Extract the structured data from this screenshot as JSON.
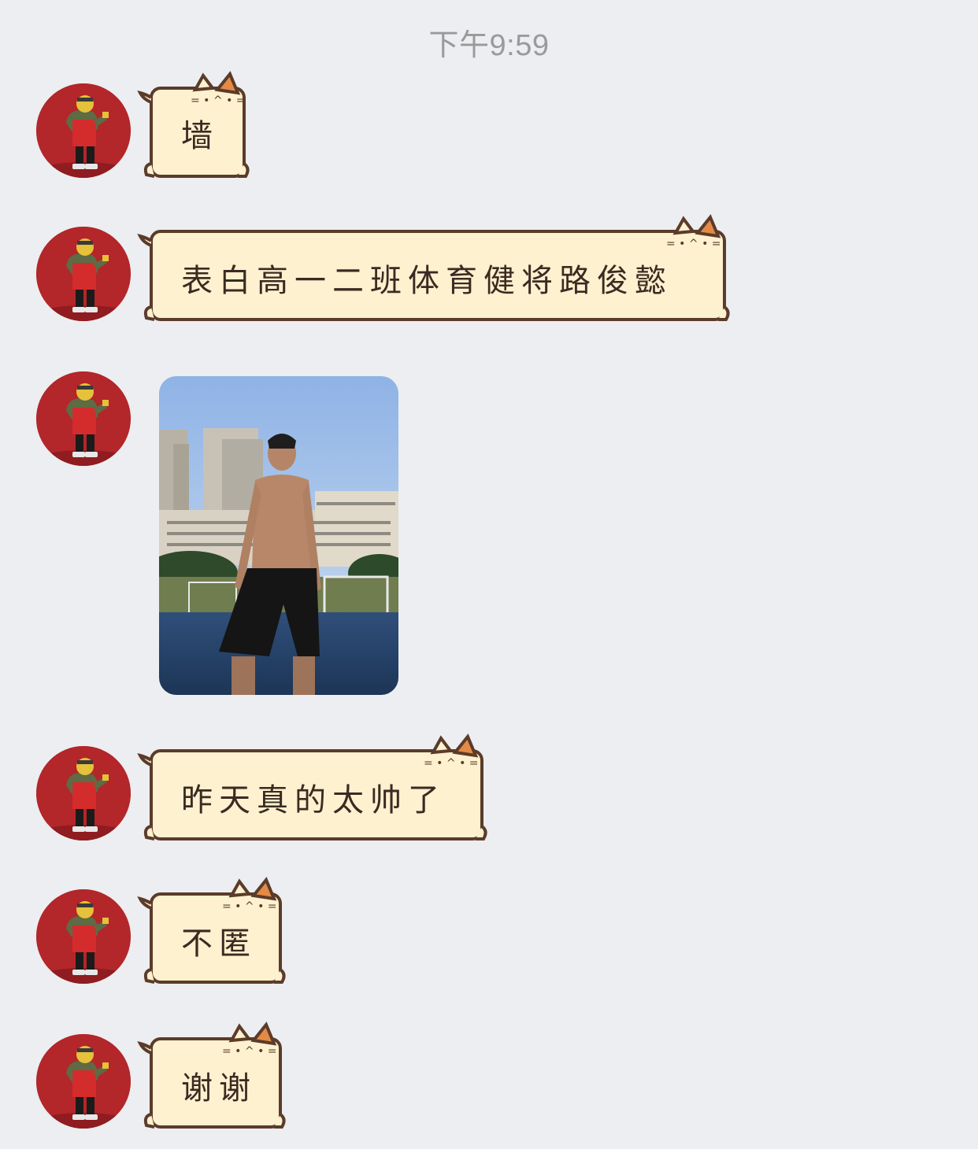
{
  "chat": {
    "timestamp": "下午9:59",
    "messages": [
      {
        "type": "text",
        "text": "墙"
      },
      {
        "type": "text",
        "text": "表白高一二班体育健将路俊懿"
      },
      {
        "type": "image"
      },
      {
        "type": "text",
        "text": "昨天真的太帅了"
      },
      {
        "type": "text",
        "text": "不匿"
      },
      {
        "type": "text",
        "text": "谢谢"
      }
    ]
  },
  "colors": {
    "background": "#eceef1",
    "bubble_fill": "#fdf1cf",
    "bubble_outline": "#5b3b2a",
    "cat_ear": "#e48a45",
    "avatar_bg": "#b3262a"
  }
}
